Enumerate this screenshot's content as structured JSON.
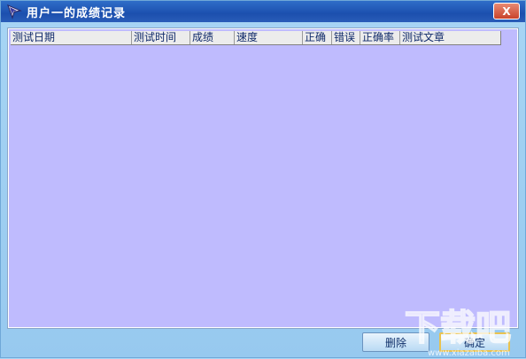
{
  "window": {
    "title": "用户一的成绩记录",
    "close_glyph": "X"
  },
  "listview": {
    "columns": [
      "测试日期",
      "测试时间",
      "成绩",
      "速度",
      "正确",
      "错误",
      "正确率",
      "测试文章"
    ],
    "rows": []
  },
  "buttons": {
    "delete_label": "删除",
    "ok_label": "确定"
  },
  "colors": {
    "title_bar": "#1c4fae",
    "list_background": "#bfbbfe",
    "window_background": "#a7d5f4"
  },
  "icons": {
    "title": "cursor-arrow-icon",
    "close": "close-icon",
    "watermark": "watermark-logo"
  },
  "watermark": {
    "text": "下载吧",
    "url": "www.xiazaiba.com"
  }
}
